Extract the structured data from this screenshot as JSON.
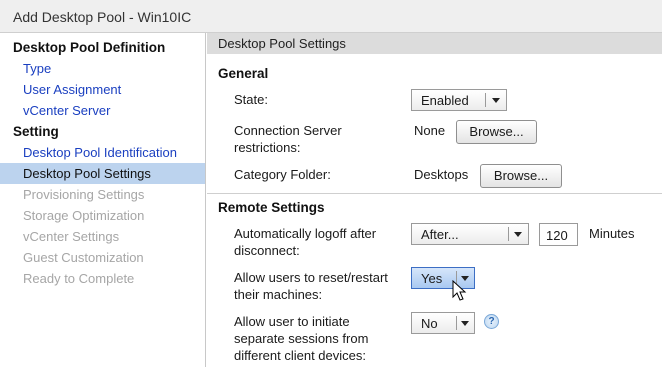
{
  "window": {
    "title": "Add Desktop Pool - Win10IC"
  },
  "sidebar": {
    "section1": "Desktop Pool Definition",
    "items1": [
      {
        "label": "Type"
      },
      {
        "label": "User Assignment"
      },
      {
        "label": "vCenter Server"
      }
    ],
    "section2": "Setting",
    "items2": [
      {
        "label": "Desktop Pool Identification"
      },
      {
        "label": "Desktop Pool Settings"
      },
      {
        "label": "Provisioning Settings"
      },
      {
        "label": "Storage Optimization"
      },
      {
        "label": "vCenter Settings"
      },
      {
        "label": "Guest Customization"
      },
      {
        "label": "Ready to Complete"
      }
    ]
  },
  "main": {
    "header": "Desktop Pool Settings",
    "general": {
      "title": "General",
      "state_label": "State:",
      "state_value": "Enabled",
      "conn_label_line1": "Connection Server",
      "conn_label_line2": "restrictions:",
      "conn_value": "None",
      "conn_browse": "Browse...",
      "category_label": "Category Folder:",
      "category_value": "Desktops",
      "category_browse": "Browse..."
    },
    "remote": {
      "title": "Remote Settings",
      "logoff_label_line1": "Automatically logoff after",
      "logoff_label_line2": "disconnect:",
      "logoff_value": "After...",
      "logoff_minutes": "120",
      "logoff_unit": "Minutes",
      "reset_label_line1": "Allow users to reset/restart",
      "reset_label_line2": "their machines:",
      "reset_value": "Yes",
      "sessions_label_line1": "Allow user to initiate",
      "sessions_label_line2": "separate sessions from",
      "sessions_label_line3": "different client devices:",
      "sessions_value": "No",
      "help_glyph": "?"
    }
  },
  "colors": {
    "selected_bg": "#bcd3ee",
    "link": "#1a3fc0",
    "disabled": "#a6a6a6",
    "active_select": "#a9c9f1"
  }
}
